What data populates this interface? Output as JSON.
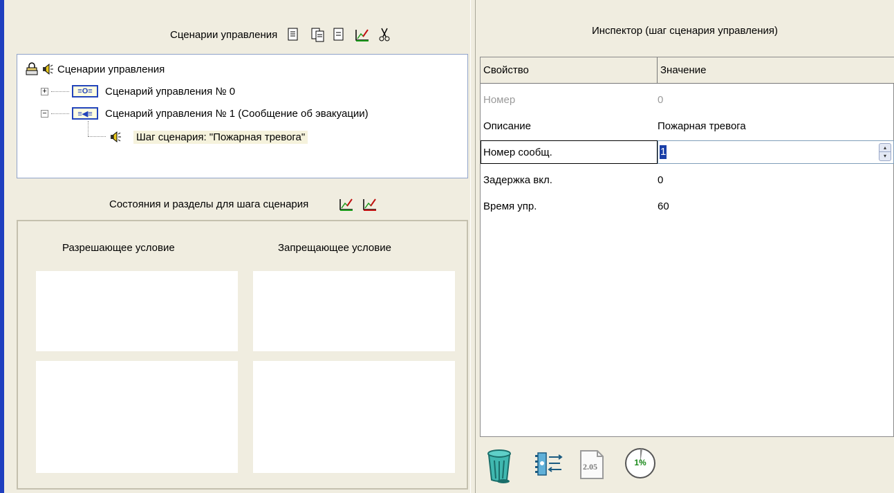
{
  "left": {
    "scenarios_header": "Сценарии управления",
    "toolbar_icons": [
      "new-document-icon",
      "copy-document-icon",
      "paste-document-icon",
      "edit-properties-icon",
      "cut-icon"
    ],
    "tree": {
      "root": "Сценарии управления",
      "items": [
        {
          "label": "Сценарий управления № 0",
          "expander": "+"
        },
        {
          "label": "Сценарий управления № 1 (Сообщение об эвакуации)",
          "expander": "−"
        }
      ],
      "step": "Шаг сценария: \"Пожарная тревога\""
    },
    "states_header": "Состояния и разделы для шага сценария",
    "allow_condition": "Разрешающее условие",
    "deny_condition": "Запрещающее условие"
  },
  "inspector": {
    "title": "Инспектор (шаг сценария управления)",
    "col_property": "Свойство",
    "col_value": "Значение",
    "rows": [
      {
        "name": "Номер",
        "value": "0"
      },
      {
        "name": "Описание",
        "value": "Пожарная тревога"
      },
      {
        "name": "Номер сообщ.",
        "value": "1"
      },
      {
        "name": "Задержка вкл.",
        "value": "0"
      },
      {
        "name": "Время упр.",
        "value": "60"
      }
    ]
  },
  "bottom": {
    "version_badge": "2.05",
    "progress_label": "1%"
  },
  "colors": {
    "panel_bg": "#f0ede0",
    "accent_blue": "#1f3fbf",
    "selection": "#1a3fa8"
  }
}
